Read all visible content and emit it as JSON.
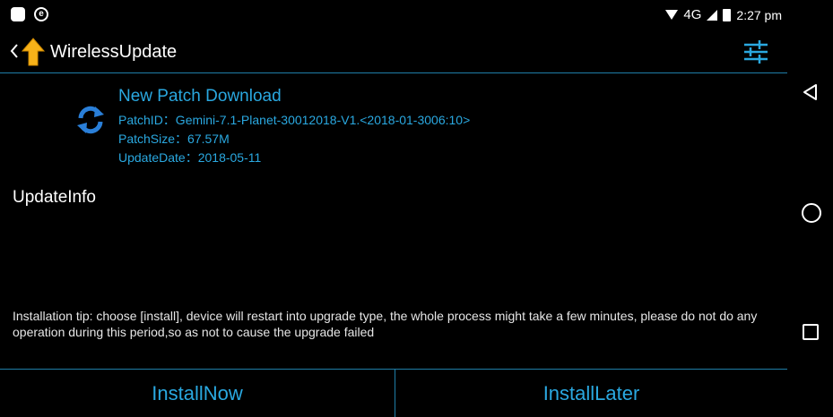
{
  "status_bar": {
    "network": "4G",
    "time": "2:27 pm",
    "icons": [
      "notification-icon",
      "e-app-icon",
      "wifi-icon",
      "signal-icon",
      "battery-icon"
    ]
  },
  "app_bar": {
    "title": "WirelessUpdate",
    "icons": [
      "back-arrow-icon",
      "update-arrow-logo-icon",
      "settings-sliders-icon"
    ]
  },
  "patch": {
    "title": "New Patch Download",
    "patch_id": "PatchID：Gemini-7.1-Planet-30012018-V1.<2018-01-3006:10>",
    "patch_size": "PatchSize：67.57M",
    "update_date": "UpdateDate：2018-05-11",
    "icon": "refresh-icon"
  },
  "update_info": {
    "heading": "UpdateInfo"
  },
  "tip": {
    "text": "Installation tip: choose [install], device will restart into upgrade type, the whole process might take a few minutes, please do not do any operation during this period,so as not to cause the upgrade failed"
  },
  "buttons": {
    "install_now": "InstallNow",
    "install_later": "InstallLater"
  },
  "nav_bar": {
    "icons": [
      "nav-back-icon",
      "nav-home-icon",
      "nav-recent-icon"
    ]
  },
  "colors": {
    "accent": "#2aa8e0",
    "divider": "#1f7ea8",
    "background": "#000000",
    "logo": "#f7b219"
  }
}
